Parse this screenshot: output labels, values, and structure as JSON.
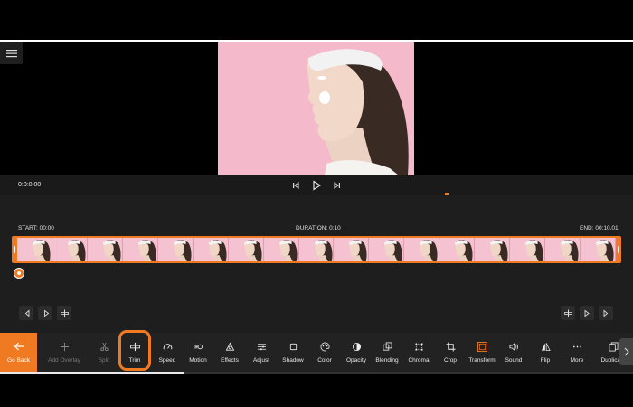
{
  "player": {
    "current_time": "0:0:0.00"
  },
  "timeline": {
    "start_label": "START: 00:00",
    "duration_label": "DURATION: 0:10",
    "end_label": "END: 00:10.01",
    "thumbnail_count": 17
  },
  "toolbar": {
    "go_back": "Go Back",
    "tools": [
      {
        "label": "Add Overlay",
        "icon": "plus-icon",
        "enabled": false
      },
      {
        "label": "Split",
        "icon": "scissors-icon",
        "enabled": false
      },
      {
        "label": "Trim",
        "icon": "trim-icon",
        "enabled": true,
        "highlighted": true
      },
      {
        "label": "Speed",
        "icon": "speedometer-icon",
        "enabled": true
      },
      {
        "label": "Motion",
        "icon": "motion-icon",
        "enabled": true
      },
      {
        "label": "Effects",
        "icon": "effects-icon",
        "enabled": true
      },
      {
        "label": "Adjust",
        "icon": "sliders-icon",
        "enabled": true
      },
      {
        "label": "Shadow",
        "icon": "shadow-icon",
        "enabled": true
      },
      {
        "label": "Color",
        "icon": "palette-icon",
        "enabled": true
      },
      {
        "label": "Opacity",
        "icon": "opacity-icon",
        "enabled": true
      },
      {
        "label": "Blending",
        "icon": "blending-icon",
        "enabled": true
      },
      {
        "label": "Chroma",
        "icon": "chroma-icon",
        "enabled": true
      },
      {
        "label": "Crop",
        "icon": "crop-icon",
        "enabled": true
      },
      {
        "label": "Transform",
        "icon": "transform-icon",
        "enabled": true
      },
      {
        "label": "Sound",
        "icon": "speaker-icon",
        "enabled": true
      },
      {
        "label": "Flip",
        "icon": "flip-icon",
        "enabled": true
      },
      {
        "label": "More",
        "icon": "more-icon",
        "enabled": true
      },
      {
        "label": "Duplicate",
        "icon": "duplicate-icon",
        "enabled": true
      }
    ],
    "scroll_progress": 0.29
  },
  "colors": {
    "accent": "#f07a22",
    "toolbar_bg": "#222222",
    "editor_bg": "#1e1e1e"
  }
}
